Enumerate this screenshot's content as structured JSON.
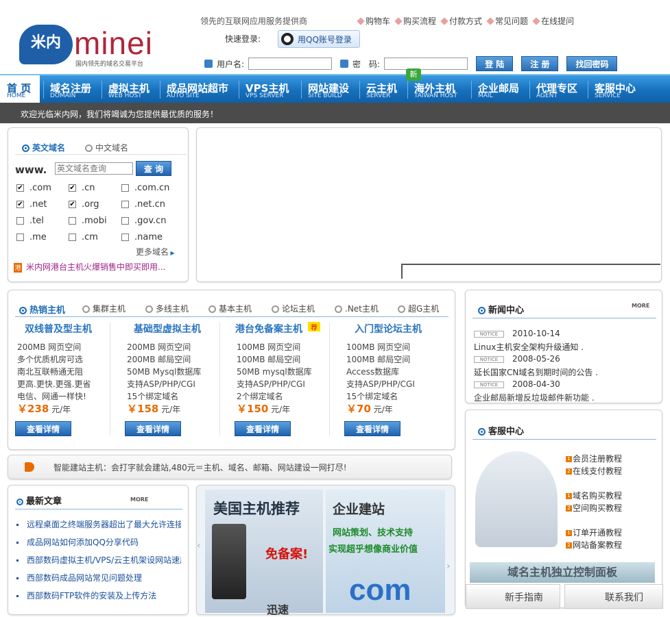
{
  "header": {
    "logo_cn": "米内",
    "logo_en": "minei",
    "logo_sub": "国内领先的域名交易平台",
    "slogan": "领先的互联网应用服务提供商",
    "top_links": [
      "购物车",
      "购买流程",
      "付款方式",
      "常见问题",
      "在线提问"
    ],
    "fast_login_label": "快速登录:",
    "qq_login": "用QQ账号登录",
    "username_label": "用户名:",
    "password_label": "密　码:",
    "btn_login": "登 陆",
    "btn_register": "注 册",
    "btn_recover": "找回密码"
  },
  "nav": {
    "items": [
      {
        "cn": "首 页",
        "en": "HOME"
      },
      {
        "cn": "域名注册",
        "en": "DOMAIN"
      },
      {
        "cn": "虚拟主机",
        "en": "WEB HOST"
      },
      {
        "cn": "成品网站超市",
        "en": "AUTO SITE"
      },
      {
        "cn": "VPS主机",
        "en": "VPS SERVER"
      },
      {
        "cn": "网站建设",
        "en": "SITE BUILD"
      },
      {
        "cn": "云主机",
        "en": "SERVER"
      },
      {
        "cn": "海外主机",
        "en": "TAIWAN HOST"
      },
      {
        "cn": "企业邮局",
        "en": "MAIL"
      },
      {
        "cn": "代理专区",
        "en": "AGENT"
      },
      {
        "cn": "客服中心",
        "en": "SERVICE"
      }
    ],
    "new_badge": "新"
  },
  "welcome": "欢迎光临米内网，我们将竭诚为您提供最优质的服务！",
  "domain": {
    "tab_en": "英文域名",
    "tab_cn": "中文域名",
    "www": "www.",
    "placeholder": "英文域名查询",
    "search_btn": "查 询",
    "tlds": [
      {
        "name": ".com",
        "checked": true
      },
      {
        "name": ".cn",
        "checked": true
      },
      {
        "name": ".com.cn",
        "checked": false
      },
      {
        "name": ".net",
        "checked": true
      },
      {
        "name": ".org",
        "checked": true
      },
      {
        "name": ".net.cn",
        "checked": false
      },
      {
        "name": ".tel",
        "checked": false
      },
      {
        "name": ".mobi",
        "checked": false
      },
      {
        "name": ".gov.cn",
        "checked": false
      },
      {
        "name": ".me",
        "checked": false
      },
      {
        "name": ".cm",
        "checked": false
      },
      {
        "name": ".name",
        "checked": false
      }
    ],
    "more": "更多域名",
    "promo": "米内网港台主机火爆销售中即买即用..."
  },
  "hosting": {
    "tabs": [
      "热销主机",
      "集群主机",
      "多线主机",
      "基本主机",
      "论坛主机",
      ".Net主机",
      "超G主机"
    ],
    "plans": [
      {
        "title": "双线普及型主机",
        "lines": [
          "200MB 网页空间",
          "多个优质机房可选",
          "南北互联畅通无阻",
          "更高.更快.更强.更省",
          "电信、网通一样快!"
        ],
        "price": "238",
        "unit": "元/年"
      },
      {
        "title": "基础型虚拟主机",
        "lines": [
          "200MB 网页空间",
          "200MB 邮局空间",
          "50MB Mysql数据库",
          "支持ASP/PHP/CGI",
          "15个绑定域名"
        ],
        "price": "158",
        "unit": "元/年"
      },
      {
        "title": "港台免备案主机",
        "lines": [
          "100MB 网页空间",
          "100MB 邮局空间",
          "50MB mysql数据库",
          "支持ASP/PHP/CGI",
          "2个绑定域名"
        ],
        "price": "150",
        "unit": "元/年"
      },
      {
        "title": "入门型论坛主机",
        "lines": [
          "100MB 网页空间",
          "100MB 邮局空间",
          "Access数据库",
          "支持ASP/PHP/CGI",
          "15个绑定域名"
        ],
        "price": "70",
        "unit": "元/年"
      }
    ],
    "recommend": "荐",
    "currency": "￥",
    "detail_btn": "查看详情"
  },
  "smartsite": "智能建站主机：会打字就会建站,480元＝主机、域名、邮箱、网站建设一网打尽!",
  "news": {
    "title": "新闻中心",
    "more": "MORE",
    "notice": "NOTICE",
    "items": [
      {
        "date": "2010-10-14",
        "text": "Linux主机安全架构升级通知 ."
      },
      {
        "date": "2008-05-26",
        "text": "延长国家CN域名到期时间的公告 ."
      },
      {
        "date": "2008-04-30",
        "text": "企业邮局新增反垃圾邮件新功能 ."
      }
    ]
  },
  "service": {
    "title": "客服中心",
    "links": [
      {
        "num": "1",
        "text": "会员注册教程"
      },
      {
        "num": "2",
        "text": "在线支付教程"
      },
      {
        "num": "1",
        "text": "域名购买教程"
      },
      {
        "num": "2",
        "text": "空间购买教程"
      },
      {
        "num": "1",
        "text": "订单开通教程"
      },
      {
        "num": "2",
        "text": "网站备案教程"
      }
    ],
    "panel_banner": "域名主机独立控制面板",
    "guide": "新手指南",
    "contact": "联系我们"
  },
  "articles": {
    "title": "最新文章",
    "more": "MORE",
    "items": [
      "远程桌面之终端服务器超出了最大允许连接数",
      "成品网站如何添加QQ分享代码",
      "西部数码虚拟主机/VPS/云主机架设网站速度",
      "西部数码成品网站常见问题处理",
      "西部数码FTP软件的安装及上传方法"
    ]
  },
  "banners": {
    "us_title": "美国主机推荐",
    "us_badge": "免备案!",
    "us_sub": "迅速",
    "corp_title": "企业建站",
    "corp_line1": "网站策划、技术支持",
    "corp_line2": "实现超乎想像商业价值",
    "corp_com": "com"
  }
}
